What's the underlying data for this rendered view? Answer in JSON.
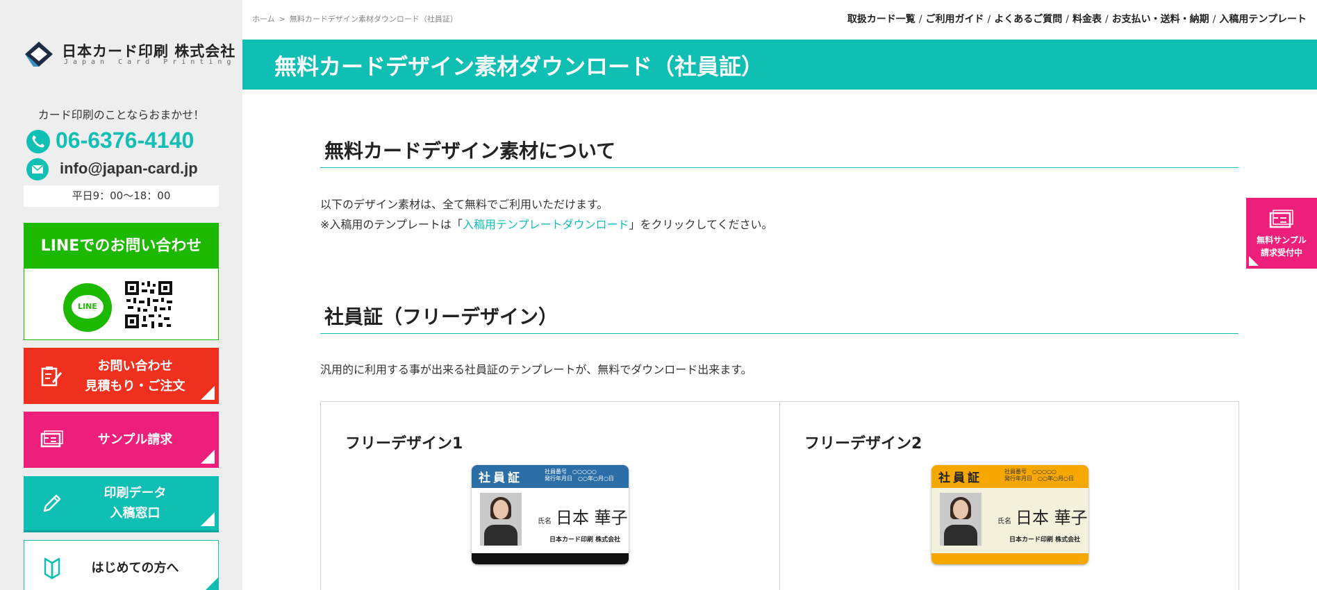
{
  "breadcrumb": [
    "ホーム",
    "無料カードデザイン素材ダウンロード（社員証）"
  ],
  "topnav": [
    "取扱カード一覧",
    "ご利用ガイド",
    "よくあるご質問",
    "料金表",
    "お支払い・送料・納期",
    "入稿用テンプレート"
  ],
  "sidebar": {
    "logo_name": "日本カード印刷 株式会社",
    "logo_sub": "Japan Card Printing",
    "tagline": "カード印刷のことならおまかせ！",
    "phone": "06-6376-4140",
    "email": "info@japan-card.jp",
    "hours": "平日9：00〜18：00",
    "line_title": "LINEでのお問い合わせ",
    "line_logo": "LINE",
    "buttons": {
      "contact_1": "お問い合わせ",
      "contact_2": "見積もり・ご注文",
      "sample": "サンプル請求",
      "data_1": "印刷データ",
      "data_2": "入稿窓口",
      "first": "はじめての方へ"
    }
  },
  "page_title": "無料カードデザイン素材ダウンロード（社員証）",
  "sections": {
    "about_title": "無料カードデザイン素材について",
    "about_p1": "以下のデザイン素材は、全て無料でご利用いただけます。",
    "about_p2_pre": "※入稿用のテンプレートは「",
    "about_p2_link": "入稿用テンプレートダウンロード",
    "about_p2_post": "」をクリックしてください。",
    "free_title": "社員証（フリーデザイン）",
    "free_p": "汎用的に利用する事が出来る社員証のテンプレートが、無料でダウンロード出来ます。"
  },
  "designs": [
    {
      "title": "フリーデザイン1",
      "card_label": "社員証",
      "meta_1": "社員番号　○○○○○",
      "meta_2": "発行年月日　○○年○月○日",
      "name_key": "氏名",
      "name_val": "日本 華子",
      "company": "日本カード印刷 株式会社"
    },
    {
      "title": "フリーデザイン2",
      "card_label": "社員証",
      "meta_1": "社員番号　○○○○○",
      "meta_2": "発行年月日　○○年○月○日",
      "name_key": "氏名",
      "name_val": "日本 華子",
      "company": "日本カード印刷 株式会社"
    }
  ],
  "float_sample": {
    "line1": "無料サンプル",
    "line2": "請求受付中"
  },
  "colors": {
    "teal": "#10bfb4",
    "line_green": "#1db800",
    "red": "#f0301f",
    "pink": "#ee1f7a"
  }
}
